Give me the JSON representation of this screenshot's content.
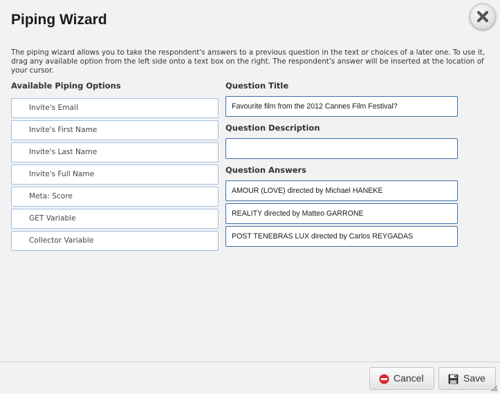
{
  "dialog": {
    "title": "Piping Wizard",
    "description": "The piping wizard allows you to take the respondent's answers to a previous question in the text or choices of a later one. To use it, drag any available option from the left side onto a text box on the right. The respondent's answer will be inserted at the location of your cursor.",
    "close_icon": "close-x-icon"
  },
  "left": {
    "heading": "Available Piping Options",
    "options": [
      "Invite's Email",
      "Invite's First Name",
      "Invite's Last Name",
      "Invite's Full Name",
      "Meta: Score",
      "GET Variable",
      "Collector Variable"
    ]
  },
  "right": {
    "title_label": "Question Title",
    "title_value": "Favourite film from the 2012 Cannes Film Festival?",
    "description_label": "Question Description",
    "description_value": "",
    "answers_label": "Question Answers",
    "answers": [
      "AMOUR (LOVE) directed by Michael HANEKE",
      "REALITY directed by Matteo GARRONE",
      "POST TENEBRAS LUX directed by Carlos REYGADAS"
    ]
  },
  "footer": {
    "cancel_label": "Cancel",
    "cancel_icon": "stop-circle-icon",
    "save_label": "Save",
    "save_icon": "floppy-disk-icon"
  },
  "colors": {
    "field_border": "#3a6ea5",
    "option_border": "#9fbfe0",
    "cancel_icon": "#d9262c",
    "background": "#f2f2f2"
  }
}
